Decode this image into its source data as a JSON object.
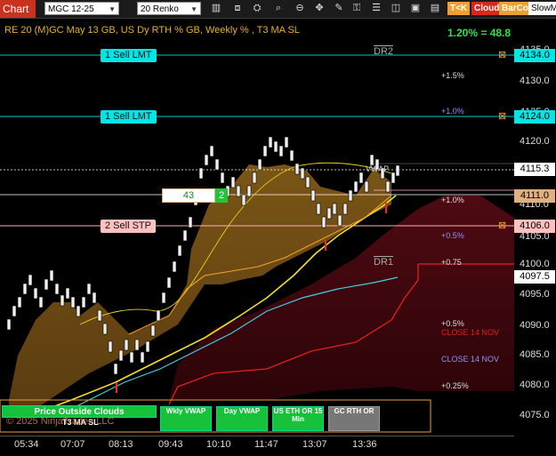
{
  "toolbar": {
    "tab": "Chart",
    "instrument": "MGC 12-25",
    "bar_type": "20 Renko",
    "tk": "T<K",
    "cloud": "Cloud",
    "barcol": "BarCol",
    "slowma": "SlowMa"
  },
  "header": {
    "title": "RE 20  (M)GC May 13 GB, US Dy RTH % GB, Weekly % , T3 MA SL",
    "pct": "1.20% = 48.8"
  },
  "price_axis": {
    "ticks": [
      "4135.0",
      "4130.0",
      "4125.0",
      "4120.0",
      "4115.0",
      "4110.0",
      "4105.0",
      "4100.0",
      "4095.0",
      "4090.0",
      "4085.0",
      "4080.0",
      "4075.0"
    ],
    "markers": [
      {
        "id": "sell1",
        "value": "4134.0",
        "bg": "#00e5e5",
        "fg": "#000"
      },
      {
        "id": "sell2",
        "value": "4124.0",
        "bg": "#00e5e5",
        "fg": "#000"
      },
      {
        "id": "last",
        "value": "4115.3",
        "bg": "#ffffff",
        "fg": "#000"
      },
      {
        "id": "avg",
        "value": "4111.0",
        "bg": "#e0b080",
        "fg": "#000"
      },
      {
        "id": "stp",
        "value": "4106.0",
        "bg": "#ffc0c0",
        "fg": "#000"
      },
      {
        "id": "low",
        "value": "4097.5",
        "bg": "#ffffff",
        "fg": "#000"
      }
    ]
  },
  "time_axis": [
    "05:34",
    "07:07",
    "08:13",
    "09:43",
    "10:10",
    "11:47",
    "13:07",
    "13:36"
  ],
  "orders": {
    "sell_lmt_1": "1 Sell LMT",
    "sell_lmt_2": "1 Sell LMT",
    "sell_stp": "2 Sell STP",
    "position_qty": "43",
    "position_count": "2"
  },
  "levels": {
    "dr2": "DR2",
    "dr1": "DR1",
    "p15": "+1.5%",
    "p10a": "+1.0%",
    "p10b": "+1.0%",
    "p05a": "+0.5%",
    "p075": "+0.75",
    "p05b": "+0.5%",
    "close_nov_red": "CLOSE 14 NOV",
    "close_nov_blue": "CLOSE 14 NOV",
    "p025": "+0.25%",
    "vwap_tag": "VWAP"
  },
  "buttons": {
    "clouds": "Price Outside Clouds",
    "t3": "T3 MA SL",
    "wkly": "Wkly VWAP",
    "day": "Day VWAP",
    "us_eth": "US ETH OR 15 Min",
    "gc_rth": "GC RTH OR"
  },
  "copyright": "© 2025 NinjaTrader, LLC",
  "colors": {
    "bull_cloud": "#6b4a14",
    "bear_cloud": "#4a0a10",
    "t3": "#f2e022",
    "cyan_ma": "#40d0e0",
    "order_line": "#00c8c8"
  }
}
